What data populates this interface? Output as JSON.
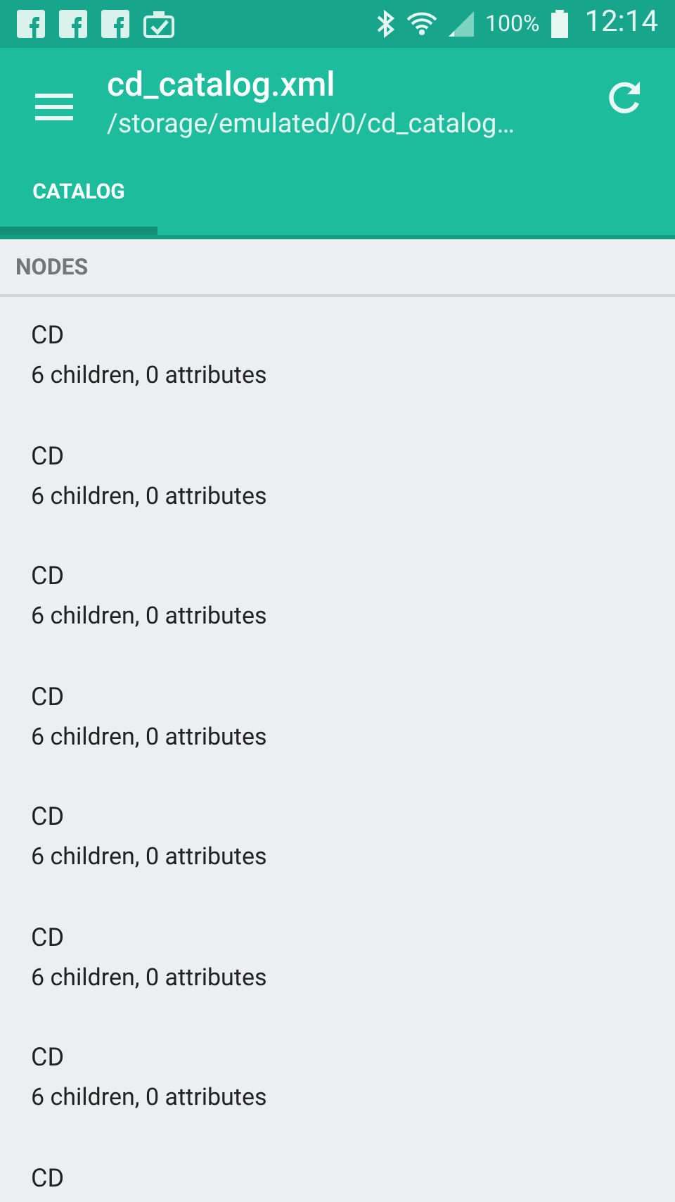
{
  "status_bar": {
    "battery": "100%",
    "time": "12:14"
  },
  "toolbar": {
    "title": "cd_catalog.xml",
    "subtitle": "/storage/emulated/0/cd_catalog…"
  },
  "tabs": [
    {
      "label": "CATALOG",
      "selected": true
    }
  ],
  "section": {
    "title": "NODES"
  },
  "nodes": [
    {
      "name": "CD",
      "details": "6 children, 0 attributes"
    },
    {
      "name": "CD",
      "details": "6 children, 0 attributes"
    },
    {
      "name": "CD",
      "details": "6 children, 0 attributes"
    },
    {
      "name": "CD",
      "details": "6 children, 0 attributes"
    },
    {
      "name": "CD",
      "details": "6 children, 0 attributes"
    },
    {
      "name": "CD",
      "details": "6 children, 0 attributes"
    },
    {
      "name": "CD",
      "details": "6 children, 0 attributes"
    },
    {
      "name": "CD"
    }
  ]
}
